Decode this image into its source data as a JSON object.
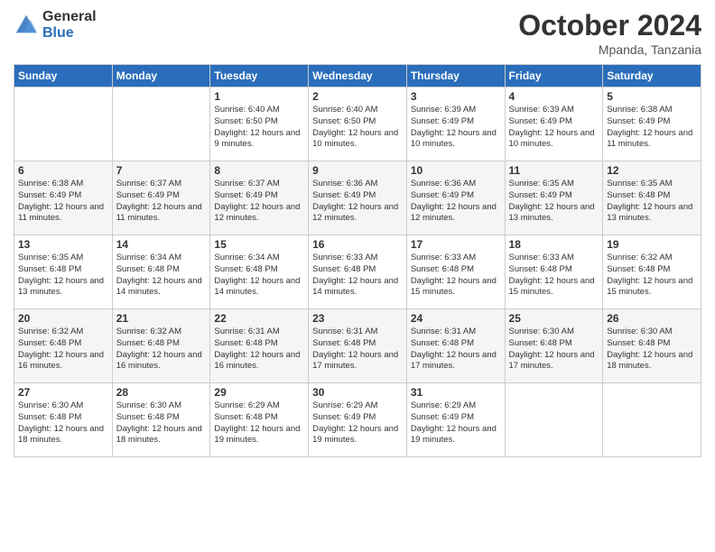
{
  "logo": {
    "general": "General",
    "blue": "Blue"
  },
  "header": {
    "month": "October 2024",
    "location": "Mpanda, Tanzania"
  },
  "weekdays": [
    "Sunday",
    "Monday",
    "Tuesday",
    "Wednesday",
    "Thursday",
    "Friday",
    "Saturday"
  ],
  "weeks": [
    [
      {
        "day": "",
        "text": ""
      },
      {
        "day": "",
        "text": ""
      },
      {
        "day": "1",
        "text": "Sunrise: 6:40 AM\nSunset: 6:50 PM\nDaylight: 12 hours and 9 minutes."
      },
      {
        "day": "2",
        "text": "Sunrise: 6:40 AM\nSunset: 6:50 PM\nDaylight: 12 hours and 10 minutes."
      },
      {
        "day": "3",
        "text": "Sunrise: 6:39 AM\nSunset: 6:49 PM\nDaylight: 12 hours and 10 minutes."
      },
      {
        "day": "4",
        "text": "Sunrise: 6:39 AM\nSunset: 6:49 PM\nDaylight: 12 hours and 10 minutes."
      },
      {
        "day": "5",
        "text": "Sunrise: 6:38 AM\nSunset: 6:49 PM\nDaylight: 12 hours and 11 minutes."
      }
    ],
    [
      {
        "day": "6",
        "text": "Sunrise: 6:38 AM\nSunset: 6:49 PM\nDaylight: 12 hours and 11 minutes."
      },
      {
        "day": "7",
        "text": "Sunrise: 6:37 AM\nSunset: 6:49 PM\nDaylight: 12 hours and 11 minutes."
      },
      {
        "day": "8",
        "text": "Sunrise: 6:37 AM\nSunset: 6:49 PM\nDaylight: 12 hours and 12 minutes."
      },
      {
        "day": "9",
        "text": "Sunrise: 6:36 AM\nSunset: 6:49 PM\nDaylight: 12 hours and 12 minutes."
      },
      {
        "day": "10",
        "text": "Sunrise: 6:36 AM\nSunset: 6:49 PM\nDaylight: 12 hours and 12 minutes."
      },
      {
        "day": "11",
        "text": "Sunrise: 6:35 AM\nSunset: 6:49 PM\nDaylight: 12 hours and 13 minutes."
      },
      {
        "day": "12",
        "text": "Sunrise: 6:35 AM\nSunset: 6:48 PM\nDaylight: 12 hours and 13 minutes."
      }
    ],
    [
      {
        "day": "13",
        "text": "Sunrise: 6:35 AM\nSunset: 6:48 PM\nDaylight: 12 hours and 13 minutes."
      },
      {
        "day": "14",
        "text": "Sunrise: 6:34 AM\nSunset: 6:48 PM\nDaylight: 12 hours and 14 minutes."
      },
      {
        "day": "15",
        "text": "Sunrise: 6:34 AM\nSunset: 6:48 PM\nDaylight: 12 hours and 14 minutes."
      },
      {
        "day": "16",
        "text": "Sunrise: 6:33 AM\nSunset: 6:48 PM\nDaylight: 12 hours and 14 minutes."
      },
      {
        "day": "17",
        "text": "Sunrise: 6:33 AM\nSunset: 6:48 PM\nDaylight: 12 hours and 15 minutes."
      },
      {
        "day": "18",
        "text": "Sunrise: 6:33 AM\nSunset: 6:48 PM\nDaylight: 12 hours and 15 minutes."
      },
      {
        "day": "19",
        "text": "Sunrise: 6:32 AM\nSunset: 6:48 PM\nDaylight: 12 hours and 15 minutes."
      }
    ],
    [
      {
        "day": "20",
        "text": "Sunrise: 6:32 AM\nSunset: 6:48 PM\nDaylight: 12 hours and 16 minutes."
      },
      {
        "day": "21",
        "text": "Sunrise: 6:32 AM\nSunset: 6:48 PM\nDaylight: 12 hours and 16 minutes."
      },
      {
        "day": "22",
        "text": "Sunrise: 6:31 AM\nSunset: 6:48 PM\nDaylight: 12 hours and 16 minutes."
      },
      {
        "day": "23",
        "text": "Sunrise: 6:31 AM\nSunset: 6:48 PM\nDaylight: 12 hours and 17 minutes."
      },
      {
        "day": "24",
        "text": "Sunrise: 6:31 AM\nSunset: 6:48 PM\nDaylight: 12 hours and 17 minutes."
      },
      {
        "day": "25",
        "text": "Sunrise: 6:30 AM\nSunset: 6:48 PM\nDaylight: 12 hours and 17 minutes."
      },
      {
        "day": "26",
        "text": "Sunrise: 6:30 AM\nSunset: 6:48 PM\nDaylight: 12 hours and 18 minutes."
      }
    ],
    [
      {
        "day": "27",
        "text": "Sunrise: 6:30 AM\nSunset: 6:48 PM\nDaylight: 12 hours and 18 minutes."
      },
      {
        "day": "28",
        "text": "Sunrise: 6:30 AM\nSunset: 6:48 PM\nDaylight: 12 hours and 18 minutes."
      },
      {
        "day": "29",
        "text": "Sunrise: 6:29 AM\nSunset: 6:48 PM\nDaylight: 12 hours and 19 minutes."
      },
      {
        "day": "30",
        "text": "Sunrise: 6:29 AM\nSunset: 6:49 PM\nDaylight: 12 hours and 19 minutes."
      },
      {
        "day": "31",
        "text": "Sunrise: 6:29 AM\nSunset: 6:49 PM\nDaylight: 12 hours and 19 minutes."
      },
      {
        "day": "",
        "text": ""
      },
      {
        "day": "",
        "text": ""
      }
    ]
  ]
}
